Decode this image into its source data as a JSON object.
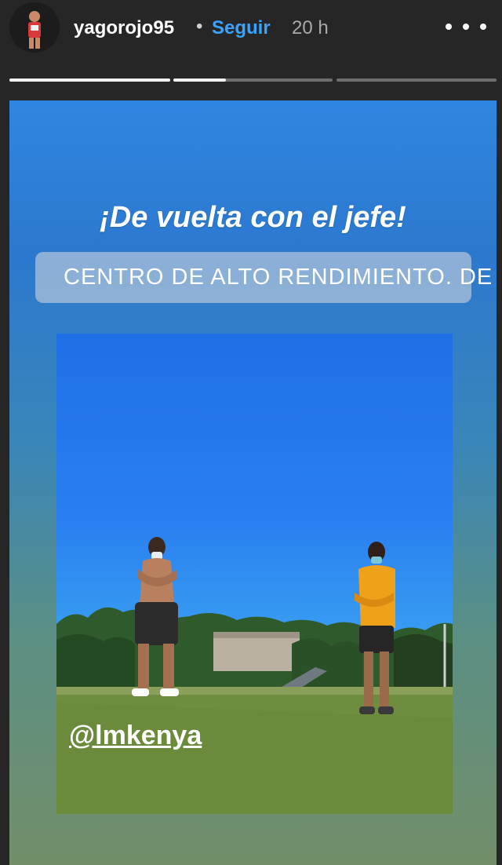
{
  "header": {
    "username": "yagorojo95",
    "separator": "•",
    "follow_label": "Seguir",
    "time": "20 h"
  },
  "progress": {
    "segments": [
      {
        "fill": 1.0
      },
      {
        "fill": 0.33
      },
      {
        "fill": 0.0
      }
    ]
  },
  "story": {
    "caption": "¡De vuelta con el jefe!",
    "location": "CENTRO DE ALTO RENDIMIENTO. DE M...",
    "mention": "@lmkenya"
  },
  "icons": {
    "more": "more-horizontal-icon",
    "location": "location-pin-icon"
  },
  "colors": {
    "follow": "#3aa3ff",
    "background": "#262626"
  }
}
